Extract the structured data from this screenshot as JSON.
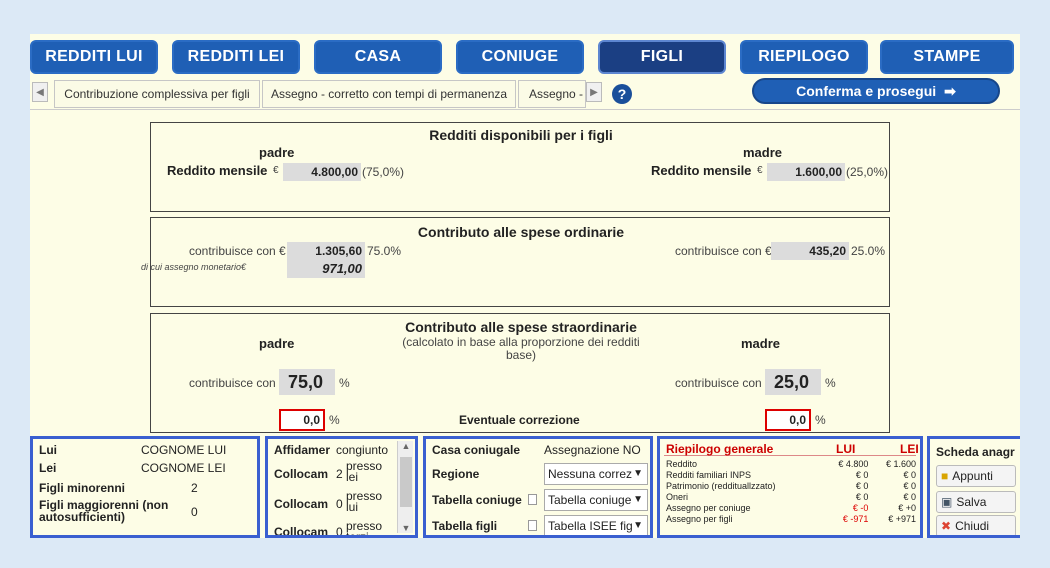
{
  "nav": {
    "redditi_lui": "REDDITI LUI",
    "redditi_lei": "REDDITI LEI",
    "casa": "CASA",
    "coniuge": "CONIUGE",
    "figli": "FIGLI",
    "riepilogo": "RIEPILOGO",
    "stampe": "STAMPE"
  },
  "tabs": {
    "t1": "Contribuzione complessiva per figli",
    "t2": "Assegno - corretto con tempi di permanenza",
    "t3": "Assegno -",
    "help": "?",
    "confirm": "Conferma e prosegui"
  },
  "disp": {
    "title": "Redditi disponibili per i figli",
    "padre": "padre",
    "madre": "madre",
    "label": "Reddito mensile",
    "euro": "€",
    "padre_val": "4.800,00",
    "padre_pct": "(75,0%)",
    "madre_val": "1.600,00",
    "madre_pct": "(25,0%)"
  },
  "ord": {
    "title": "Contributo alle spese ordinarie",
    "contrib_label": "contribuisce con €",
    "padre_val": "1.305,60",
    "padre_pct": "75.0%",
    "madre_val": "435,20",
    "madre_pct": "25.0%",
    "assegno_label": "di cui assegno monetario€",
    "assegno_val": "971,00"
  },
  "straord": {
    "title": "Contributo alle spese straordinarie",
    "subtitle": "(calcolato in base alla proporzione dei redditi base)",
    "padre": "padre",
    "madre": "madre",
    "contrib_label": "contribuisce con",
    "padre_val": "75,0",
    "madre_val": "25,0",
    "pct": "%",
    "corr_label": "Eventuale correzione",
    "padre_corr": "0,0",
    "madre_corr": "0,0"
  },
  "info": {
    "lui_label": "Lui",
    "lui_val": "COGNOME LUI",
    "lei_label": "Lei",
    "lei_val": "COGNOME LEI",
    "minori_label": "Figli minorenni",
    "minori_val": "2",
    "maggiori_label": "Figli maggiorenni (non autosufficienti)",
    "maggiori_val": "0"
  },
  "aff": {
    "aff_label": "Affidamer",
    "aff_val": "congiunto",
    "c1_label": "Collocam",
    "c1_num": "2",
    "c1_val": "presso lei",
    "c2_label": "Collocam",
    "c2_num": "0",
    "c2_val": "presso lui",
    "c3_label": "Collocam",
    "c3_num": "0",
    "c3_val": "presso terzi"
  },
  "casa": {
    "casa_label": "Casa coniugale",
    "casa_val": "Assegnazione  NO",
    "regione_label": "Regione",
    "regione_val": "Nessuna correz",
    "tab_con_label": "Tabella coniuge",
    "tab_con_val": "Tabella coniuge",
    "tab_figli_label": "Tabella figli",
    "tab_figli_val": "Tabella ISEE fig"
  },
  "riep": {
    "title": "Riepilogo generale",
    "lui": "LUI",
    "lei": "LEI",
    "rows": [
      {
        "label": "Reddito",
        "lui": "€ 4.800",
        "lei": "€ 1.600"
      },
      {
        "label": "Redditi familiari INPS",
        "lui": "€ 0",
        "lei": "€ 0"
      },
      {
        "label": "Patrimonio (reddituallzzato)",
        "lui": "€ 0",
        "lei": "€ 0"
      },
      {
        "label": "Oneri",
        "lui": "€ 0",
        "lei": "€ 0"
      },
      {
        "label": "Assegno per coniuge",
        "lui": "€ -0",
        "lei": "€ +0"
      },
      {
        "label": "Assegno per figli",
        "lui": "€ -971",
        "lei": "€ +971"
      }
    ]
  },
  "side": {
    "title": "Scheda anagr",
    "appunti": "Appunti",
    "salva": "Salva",
    "chiudi": "Chiudi"
  }
}
